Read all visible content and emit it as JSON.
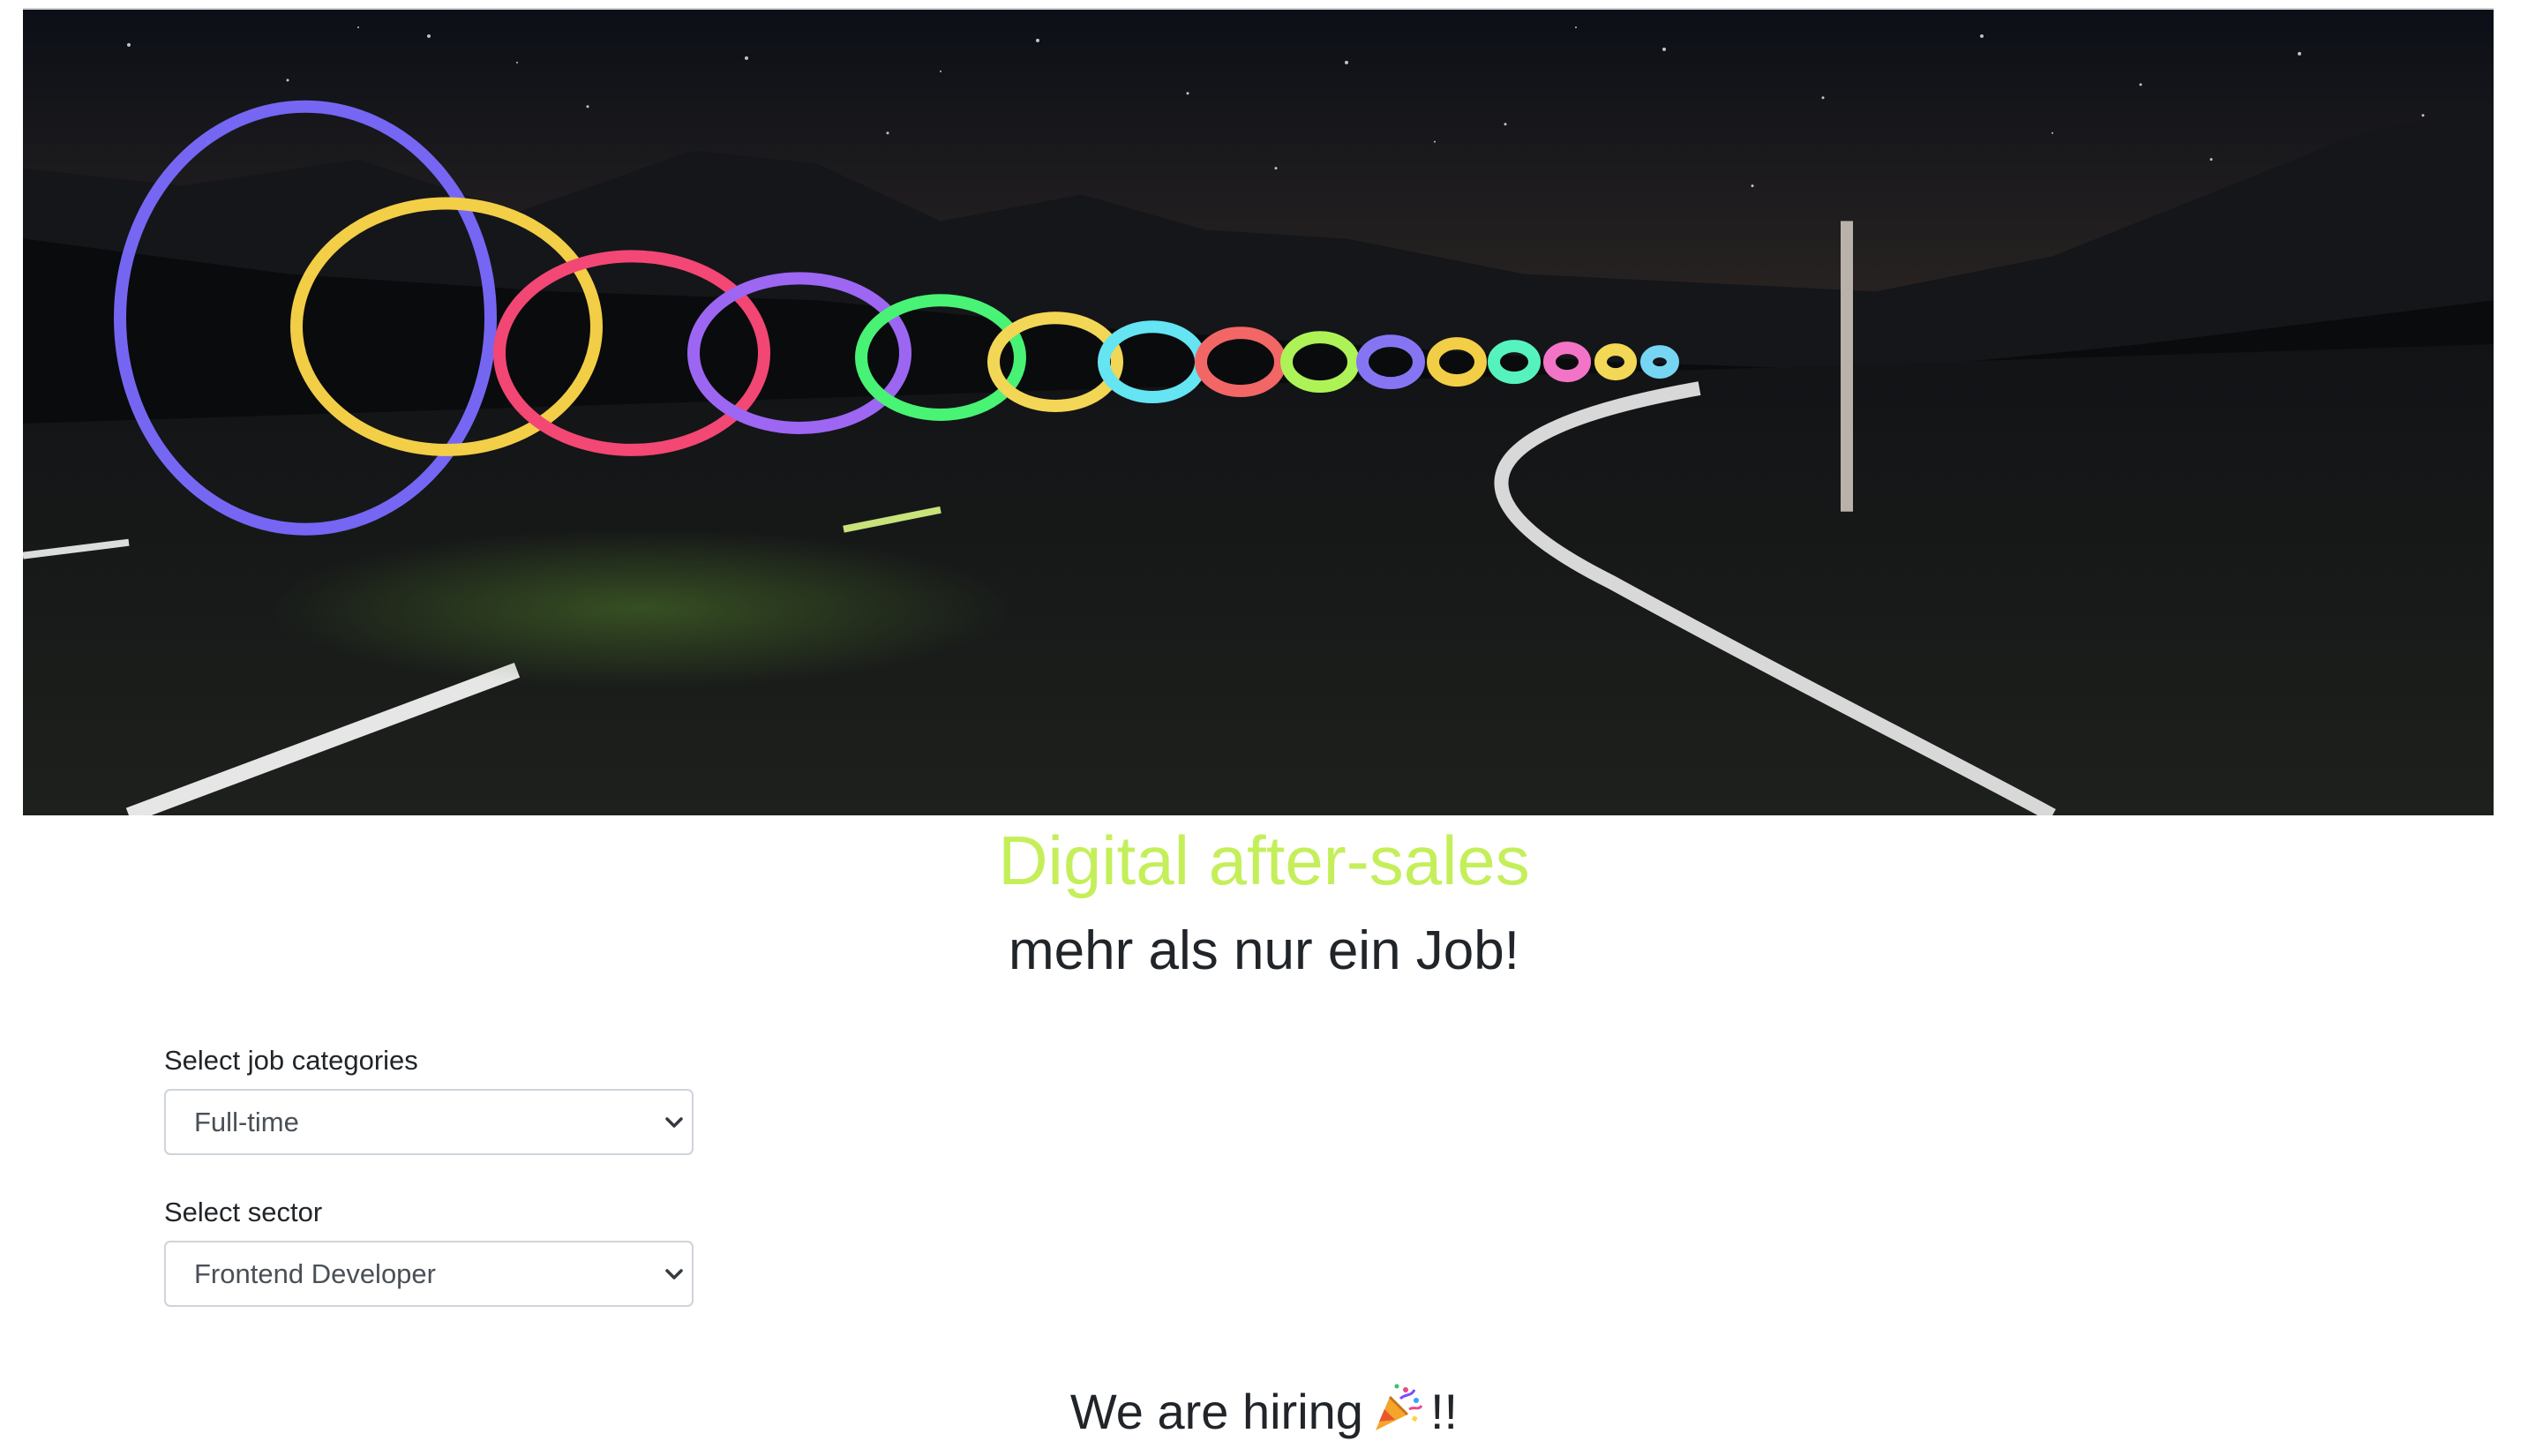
{
  "hero": {
    "image_name": "night-road-light-spiral",
    "alt": "Light spiral over a night road under a starry sky"
  },
  "headline": {
    "title": "Digital after-sales",
    "subtitle": "mehr als nur ein Job!",
    "title_color": "#c4ef5a"
  },
  "form": {
    "job_category": {
      "label": "Select job categories",
      "value": "Full-time"
    },
    "sector": {
      "label": "Select sector",
      "value": "Frontend Developer"
    }
  },
  "hiring": {
    "text_before": "We are hiring",
    "emoji_icon": "party-popper-icon",
    "text_after": "!!"
  }
}
